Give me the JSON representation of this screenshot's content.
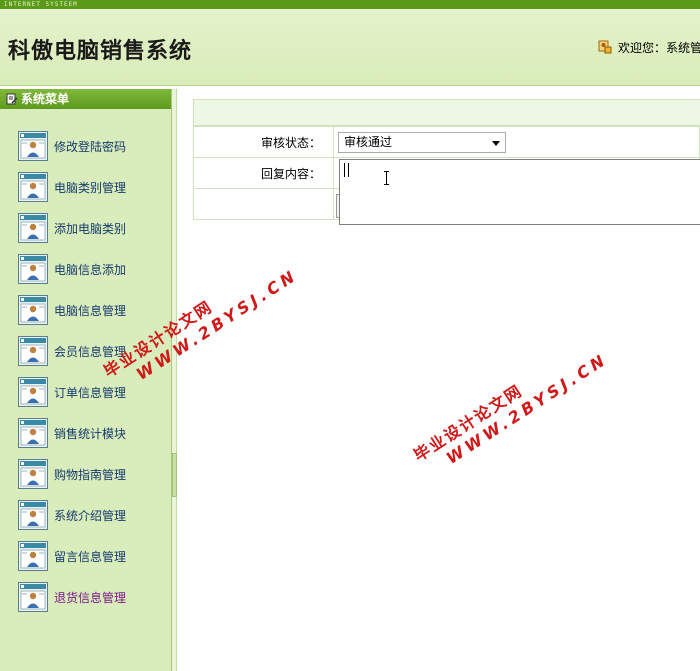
{
  "top_strip": {
    "text": "INTERNET SYSTEEM"
  },
  "header": {
    "title": "科傲电脑销售系统",
    "welcome": "欢迎您：系统管"
  },
  "sidebar": {
    "title": "系统菜单",
    "items": [
      {
        "label": "修改登陆密码"
      },
      {
        "label": "电脑类别管理"
      },
      {
        "label": "添加电脑类别"
      },
      {
        "label": "电脑信息添加"
      },
      {
        "label": "电脑信息管理"
      },
      {
        "label": "会员信息管理"
      },
      {
        "label": "订单信息管理"
      },
      {
        "label": "销售统计模块"
      },
      {
        "label": "购物指南管理"
      },
      {
        "label": "系统介绍管理"
      },
      {
        "label": "留言信息管理"
      },
      {
        "label": "退货信息管理"
      }
    ]
  },
  "form": {
    "status_label": "审核状态：",
    "status_value": "审核通过",
    "reply_label": "回复内容：",
    "reply_value": ""
  },
  "watermarks": [
    {
      "brand": "毕业设计论文网",
      "url": "WWW.2BYSJ.CN"
    },
    {
      "brand": "毕业设计论文网",
      "url": "WWW.2BYSJ.CN"
    }
  ],
  "colors": {
    "accent_green": "#5e9a1f",
    "sidebar_bg": "#d9ecbb",
    "watermark_red": "#d01818",
    "menu_text": "#163a6e"
  },
  "icons": {
    "menu_item": "user-card-icon",
    "sidebar_head": "edit-note-icon",
    "welcome": "user-lock-icon"
  }
}
